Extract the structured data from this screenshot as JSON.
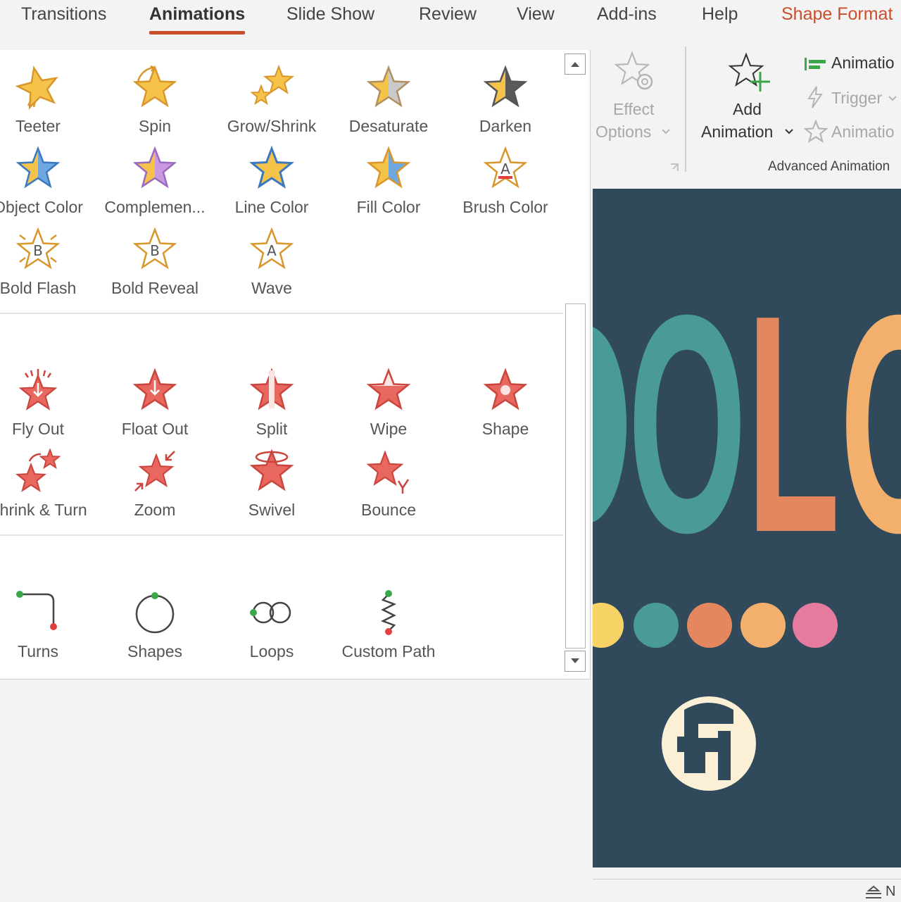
{
  "tabs": [
    {
      "label": "Transitions"
    },
    {
      "label": "Animations"
    },
    {
      "label": "Slide Show"
    },
    {
      "label": "Review"
    },
    {
      "label": "View"
    },
    {
      "label": "Add-ins"
    },
    {
      "label": "Help"
    },
    {
      "label": "Shape Format"
    }
  ],
  "colors": {
    "accent": "#c94f2c",
    "emphasis_icon": "#f5c24a",
    "exit_icon": "#e8675f",
    "slide_bg": "#304a5b"
  },
  "gallery": {
    "emphasis": [
      {
        "label": "Teeter",
        "icon": "teeter-icon"
      },
      {
        "label": "Spin",
        "icon": "spin-icon"
      },
      {
        "label": "Grow/Shrink",
        "icon": "grow-shrink-icon"
      },
      {
        "label": "Desaturate",
        "icon": "desaturate-icon"
      },
      {
        "label": "Darken",
        "icon": "darken-icon"
      },
      {
        "label": "Object Color",
        "icon": "object-color-icon"
      },
      {
        "label": "Complemen...",
        "icon": "complementary-color-icon"
      },
      {
        "label": "Line Color",
        "icon": "line-color-icon"
      },
      {
        "label": "Fill Color",
        "icon": "fill-color-icon"
      },
      {
        "label": "Brush Color",
        "icon": "brush-color-icon"
      },
      {
        "label": "Bold Flash",
        "icon": "bold-flash-icon"
      },
      {
        "label": "Bold Reveal",
        "icon": "bold-reveal-icon"
      },
      {
        "label": "Wave",
        "icon": "wave-icon"
      }
    ],
    "exit": [
      {
        "label": "Fly Out",
        "icon": "fly-out-icon"
      },
      {
        "label": "Float Out",
        "icon": "float-out-icon"
      },
      {
        "label": "Split",
        "icon": "split-icon"
      },
      {
        "label": "Wipe",
        "icon": "wipe-icon"
      },
      {
        "label": "Shape",
        "icon": "shape-icon"
      },
      {
        "label": "Shrink & Turn",
        "icon": "shrink-turn-icon"
      },
      {
        "label": "Zoom",
        "icon": "zoom-icon"
      },
      {
        "label": "Swivel",
        "icon": "swivel-icon"
      },
      {
        "label": "Bounce",
        "icon": "bounce-icon"
      }
    ],
    "motion_paths": [
      {
        "label": "Turns",
        "icon": "turns-path-icon"
      },
      {
        "label": "Shapes",
        "icon": "shapes-path-icon"
      },
      {
        "label": "Loops",
        "icon": "loops-path-icon"
      },
      {
        "label": "Custom Path",
        "icon": "custom-path-icon"
      }
    ]
  },
  "ribbon": {
    "effect_options": {
      "line1": "Effect",
      "line2": "Options"
    },
    "add_animation": {
      "line1": "Add",
      "line2": "Animation"
    },
    "animation_pane_label": "Animatio",
    "trigger_label": "Trigger",
    "animation_painter_label": "Animatio",
    "group_label": "Advanced Animation"
  },
  "slide": {
    "title_text": "OLO",
    "dot_colors": [
      "#f7d366",
      "#4a9a98",
      "#e5875e",
      "#f2b06c",
      "#e57b9e"
    ]
  },
  "statusbar": {
    "notes_label": "N"
  }
}
